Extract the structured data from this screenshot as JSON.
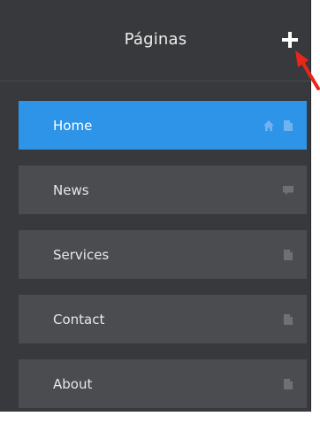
{
  "header": {
    "title": "Páginas"
  },
  "pages": [
    {
      "label": "Home",
      "active": true,
      "icons": [
        "home-icon",
        "page-icon"
      ]
    },
    {
      "label": "News",
      "active": false,
      "icons": [
        "chat-icon"
      ]
    },
    {
      "label": "Services",
      "active": false,
      "icons": [
        "page-icon"
      ]
    },
    {
      "label": "Contact",
      "active": false,
      "icons": [
        "page-icon"
      ]
    },
    {
      "label": "About",
      "active": false,
      "icons": [
        "page-icon"
      ]
    }
  ],
  "colors": {
    "panel": "#37393c",
    "item": "#4a4c4f",
    "active": "#2e94e8",
    "annotation_arrow": "#e8261c"
  }
}
